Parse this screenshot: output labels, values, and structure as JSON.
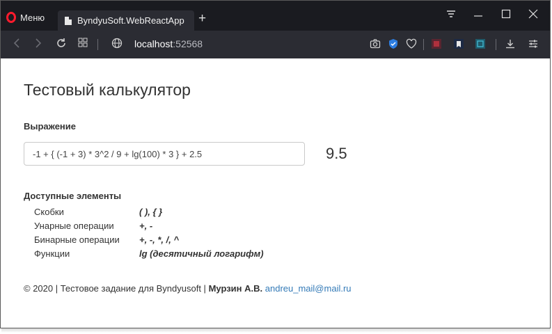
{
  "browser": {
    "menu_label": "Меню",
    "tab_title": "ByndyuSoft.WebReactApp",
    "url_host": "localhost",
    "url_port": ":52568",
    "colors": {
      "tabbar": "#1a1b20",
      "toolbar": "#2b2c33",
      "opera_red": "#ff1b2d"
    }
  },
  "calculator": {
    "title": "Тестовый калькулятор",
    "expression_label": "Выражение",
    "expression_value": "-1 + { (-1 + 3) * 3^2 / 9 + lg(100) * 3 } + 2.5",
    "result": "9.5"
  },
  "available": {
    "title": "Доступные элементы",
    "items": [
      {
        "name": "Скобки",
        "value": "( ), { }"
      },
      {
        "name": "Унарные операции",
        "value": "+, -"
      },
      {
        "name": "Бинарные операции",
        "value": "+, -, *, /, ^"
      },
      {
        "name": "Функции",
        "value": "lg (десятичный логарифм)"
      }
    ]
  },
  "footer": {
    "text": "© 2020 | Тестовое задание для Byndyusoft |",
    "author": "Мурзин А.В.",
    "email": "andreu_mail@mail.ru",
    "link_color": "#337ab7"
  }
}
